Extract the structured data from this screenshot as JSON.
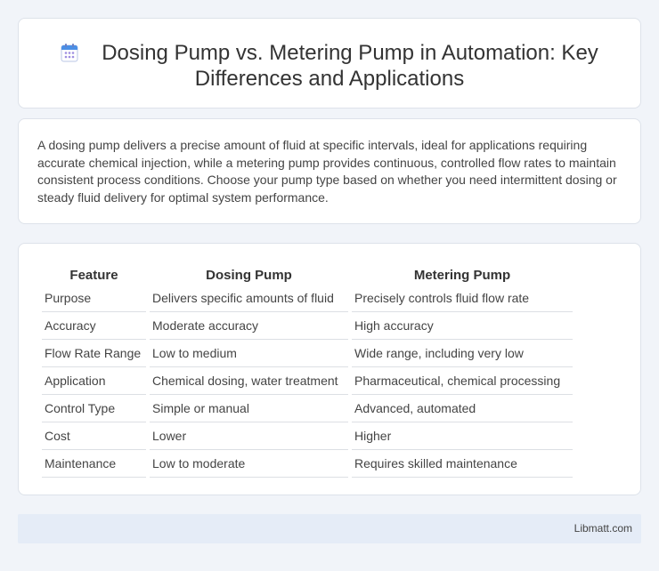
{
  "header": {
    "icon": "calendar-icon",
    "title": "Dosing Pump vs. Metering Pump in Automation: Key Differences and Applications"
  },
  "intro": {
    "text": "A dosing pump delivers a precise amount of fluid at specific intervals, ideal for applications requiring accurate chemical injection, while a metering pump provides continuous, controlled flow rates to maintain consistent process conditions. Choose your pump type based on whether you need intermittent dosing or steady fluid delivery for optimal system performance."
  },
  "table": {
    "headers": [
      "Feature",
      "Dosing Pump",
      "Metering Pump"
    ],
    "rows": [
      [
        "Purpose",
        "Delivers specific amounts of fluid",
        "Precisely controls fluid flow rate"
      ],
      [
        "Accuracy",
        "Moderate accuracy",
        "High accuracy"
      ],
      [
        "Flow Rate Range",
        "Low to medium",
        "Wide range, including very low"
      ],
      [
        "Application",
        "Chemical dosing, water treatment",
        "Pharmaceutical, chemical processing"
      ],
      [
        "Control Type",
        "Simple or manual",
        "Advanced, automated"
      ],
      [
        "Cost",
        "Lower",
        "Higher"
      ],
      [
        "Maintenance",
        "Low to moderate",
        "Requires skilled maintenance"
      ]
    ]
  },
  "footer": {
    "text": "Libmatt.com"
  },
  "colors": {
    "background": "#f1f4f9",
    "card": "#ffffff",
    "footer_bg": "#e5ecf7",
    "icon_blue": "#4a8fe6",
    "icon_purple": "#9f8ee0"
  }
}
